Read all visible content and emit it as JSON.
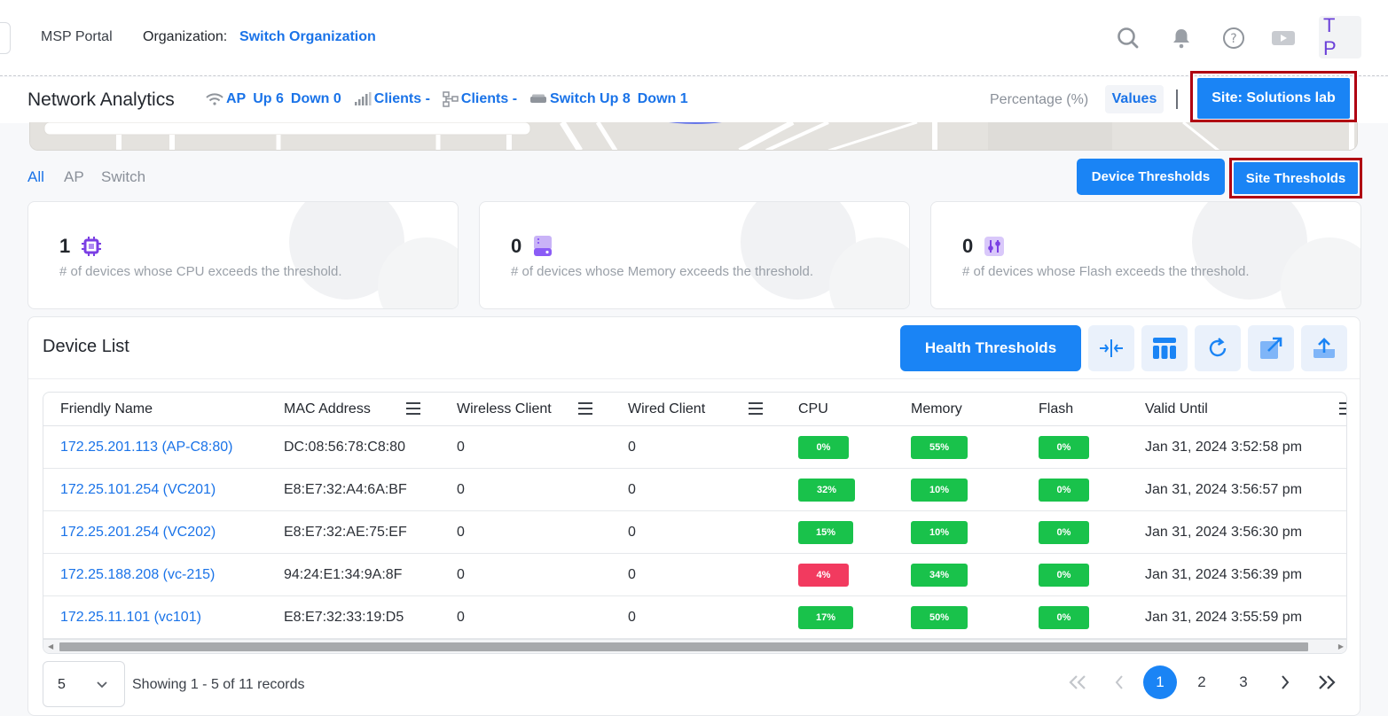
{
  "header": {
    "portal_name": "MSP Portal",
    "organization_label": "Organization:",
    "organization_link": "Switch Organization",
    "avatar_initials": "T P"
  },
  "subheader": {
    "title": "Network Analytics",
    "ap_label": "AP",
    "ap_up": "Up 6",
    "ap_down": "Down 0",
    "clients_wireless": "Clients -",
    "clients_wired": "Clients -",
    "switch_up": "Switch Up 8",
    "switch_down": "Down 1",
    "percentage_toggle": "Percentage (%)",
    "values_toggle": "Values",
    "site_button": "Site: Solutions lab"
  },
  "filters": {
    "tabs": [
      "All",
      "AP",
      "Switch"
    ],
    "active": "All",
    "device_thresholds_button": "Device Thresholds",
    "site_thresholds_button": "Site Thresholds"
  },
  "cards": [
    {
      "count": "1",
      "description": "# of devices whose CPU exceeds the threshold.",
      "icon": "cpu-icon",
      "color": "#7b3fe4"
    },
    {
      "count": "0",
      "description": "# of devices whose Memory exceeds the threshold.",
      "icon": "memory-icon",
      "color": "#8b5cf6"
    },
    {
      "count": "0",
      "description": "# of devices whose Flash exceeds the threshold.",
      "icon": "flash-icon",
      "color": "#8b5cf6"
    }
  ],
  "device_list": {
    "title": "Device List",
    "health_thresholds_button": "Health Thresholds",
    "columns": [
      "Friendly Name",
      "MAC Address",
      "Wireless Client",
      "Wired Client",
      "CPU",
      "Memory",
      "Flash",
      "Valid Until"
    ],
    "rows": [
      {
        "name": "172.25.201.113 (AP-C8:80)",
        "mac": "DC:08:56:78:C8:80",
        "wireless": "0",
        "wired": "0",
        "cpu": "0%",
        "cpu_status": "ok",
        "memory": "55%",
        "flash": "0%",
        "valid_until": "Jan 31, 2024 3:52:58 pm"
      },
      {
        "name": "172.25.101.254 (VC201)",
        "mac": "E8:E7:32:A4:6A:BF",
        "wireless": "0",
        "wired": "0",
        "cpu": "32%",
        "cpu_status": "ok",
        "memory": "10%",
        "flash": "0%",
        "valid_until": "Jan 31, 2024 3:56:57 pm"
      },
      {
        "name": "172.25.201.254 (VC202)",
        "mac": "E8:E7:32:AE:75:EF",
        "wireless": "0",
        "wired": "0",
        "cpu": "15%",
        "cpu_status": "ok",
        "memory": "10%",
        "flash": "0%",
        "valid_until": "Jan 31, 2024 3:56:30 pm"
      },
      {
        "name": "172.25.188.208 (vc-215)",
        "mac": "94:24:E1:34:9A:8F",
        "wireless": "0",
        "wired": "0",
        "cpu": "4%",
        "cpu_status": "alert",
        "memory": "34%",
        "flash": "0%",
        "valid_until": "Jan 31, 2024 3:56:39 pm"
      },
      {
        "name": "172.25.11.101 (vc101)",
        "mac": "E8:E7:32:33:19:D5",
        "wireless": "0",
        "wired": "0",
        "cpu": "17%",
        "cpu_status": "ok",
        "memory": "50%",
        "flash": "0%",
        "valid_until": "Jan 31, 2024 3:55:59 pm"
      }
    ]
  },
  "pagination": {
    "page_size": "5",
    "showing": "Showing 1 - 5 of 11 records",
    "pages": [
      "1",
      "2",
      "3"
    ],
    "current": "1"
  },
  "colors": {
    "primary": "#1a84f5",
    "link": "#1a73e8",
    "ok": "#19c24b",
    "alert": "#f23a5f",
    "highlight_border": "#b00012"
  }
}
